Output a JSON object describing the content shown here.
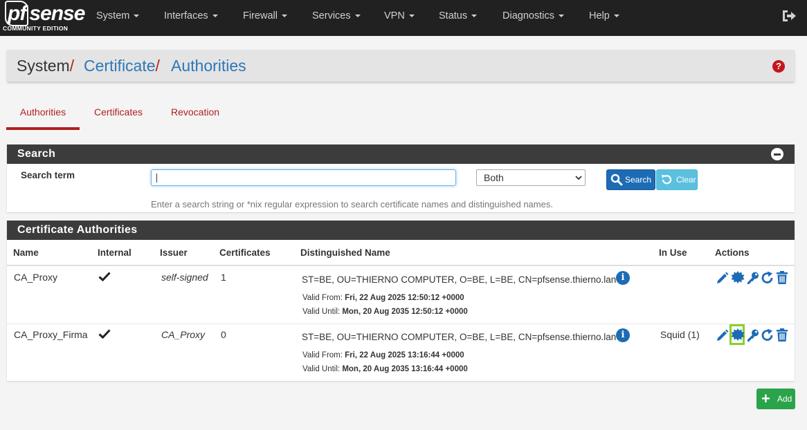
{
  "brand": {
    "name": "pfsense",
    "edition": "COMMUNITY EDITION"
  },
  "nav": {
    "items": [
      {
        "label": "System"
      },
      {
        "label": "Interfaces"
      },
      {
        "label": "Firewall"
      },
      {
        "label": "Services"
      },
      {
        "label": "VPN"
      },
      {
        "label": "Status"
      },
      {
        "label": "Diagnostics"
      },
      {
        "label": "Help"
      }
    ]
  },
  "breadcrumb": {
    "root": "System",
    "level1": "Certificate",
    "level2": "Authorities",
    "separator": "/"
  },
  "tabs": [
    {
      "label": "Authorities",
      "active": true
    },
    {
      "label": "Certificates",
      "active": false
    },
    {
      "label": "Revocation",
      "active": false
    }
  ],
  "search": {
    "panel_title": "Search",
    "term_label": "Search term",
    "term_value": "",
    "scope_selected": "Both",
    "search_button": "Search",
    "clear_button": "Clear",
    "help_text": "Enter a search string or *nix regular expression to search certificate names and distinguished names."
  },
  "ca_table": {
    "panel_title": "Certificate Authorities",
    "columns": [
      "Name",
      "Internal",
      "Issuer",
      "Certificates",
      "Distinguished Name",
      "In Use",
      "Actions"
    ],
    "rows": [
      {
        "name": "CA_Proxy",
        "internal": true,
        "issuer": "self-signed",
        "certificates": "1",
        "dn": "ST=BE, OU=THIERNO COMPUTER, O=BE, L=BE, CN=pfsense.thierno.lan",
        "valid_from_label": "Valid From:",
        "valid_from": "Fri, 22 Aug 2025 12:50:12 +0000",
        "valid_until_label": "Valid Until:",
        "valid_until": "Mon, 20 Aug 2035 12:50:12 +0000",
        "in_use": ""
      },
      {
        "name": "CA_Proxy_Firma",
        "internal": true,
        "issuer": "CA_Proxy",
        "certificates": "0",
        "dn": "ST=BE, OU=THIERNO COMPUTER, O=BE, L=BE, CN=pfsense.thierno.lan",
        "valid_from_label": "Valid From:",
        "valid_from": "Fri, 22 Aug 2025 13:16:44 +0000",
        "valid_until_label": "Valid Until:",
        "valid_until": "Mon, 20 Aug 2035 13:16:44 +0000",
        "in_use": "Squid (1)"
      }
    ]
  },
  "add_button": "Add",
  "colors": {
    "brand_red": "#b21f1f",
    "link_blue": "#2c77b8",
    "primary": "#1d6bb5",
    "success": "#2ba34a",
    "highlight": "#8ad122",
    "navbar": "#212121"
  }
}
